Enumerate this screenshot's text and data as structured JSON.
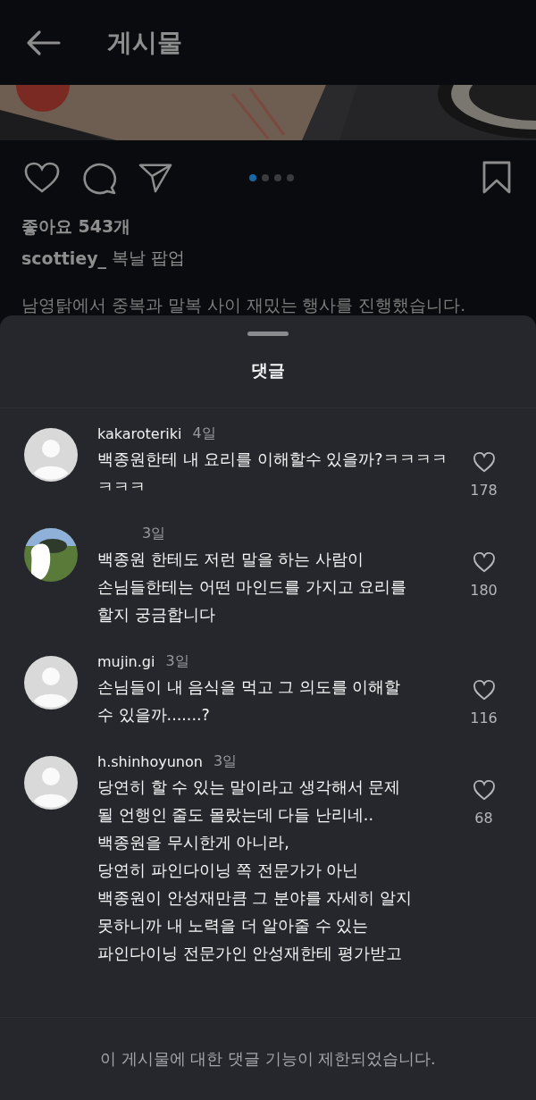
{
  "header": {
    "title": "게시물"
  },
  "post": {
    "carousel": [
      {
        "selected": true
      },
      {
        "selected": false
      },
      {
        "selected": false
      },
      {
        "selected": false
      }
    ],
    "likes": "좋아요 543개",
    "author": "scottiey_",
    "caption_title": "복날 팝업",
    "caption": "남영탉에서 중복과 말복 사이 재밌는 행사를 진행했습니다."
  },
  "comments_sheet": {
    "title": "댓글",
    "comments": [
      {
        "avatar": {
          "kind": "default"
        },
        "username": "kakaroteriki",
        "time": "4일",
        "text": "백종원한테 내 요리를 이해할수 있을까?ㅋㅋㅋㅋㅋㅋㅋ",
        "like_count": "178"
      },
      {
        "time": "3일",
        "text": "백종원 한테도 저런 말을 하는 사람이\n손님들한테는 어떤 마인드를 가지고 요리를\n할지 궁금합니다",
        "like_count": "180"
      },
      {
        "avatar": {
          "kind": "default"
        },
        "username": "mujin.gi",
        "time": "3일",
        "text": "손님들이 내 음식을 먹고 그 의도를 이해할\n수 있을까.......?",
        "like_count": "116"
      },
      {
        "avatar": {
          "kind": "default"
        },
        "username": "h.shinhoyunon",
        "time": "3일",
        "text": "당연히 할 수 있는 말이라고 생각해서 문제\n될 언행인 줄도 몰랐는데 다들 난리네..\n백종원을 무시한게 아니라,\n당연히 파인다이닝 쪽 전문가가 아닌\n백종원이 안성재만큼 그 분야를 자세히 알지\n못하니까 내 노력을 더 알아줄 수 있는\n파인다이닝 전문가인 안성재한테 평가받고",
        "like_count": "68"
      }
    ],
    "notice": "이 게시물에 대한 댓글 기능이 제한되었습니다."
  }
}
